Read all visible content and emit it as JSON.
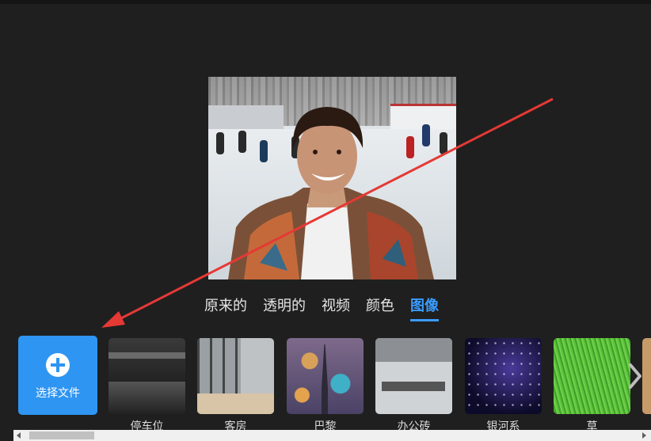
{
  "tabs": [
    {
      "label": "原来的"
    },
    {
      "label": "透明的"
    },
    {
      "label": "视频"
    },
    {
      "label": "颜色"
    },
    {
      "label": "图像",
      "active": true
    }
  ],
  "upload": {
    "label": "选择文件",
    "icon": "plus-circle-icon"
  },
  "backgrounds": [
    {
      "label": "停车位"
    },
    {
      "label": "客房"
    },
    {
      "label": "巴黎"
    },
    {
      "label": "办公砖"
    },
    {
      "label": "银河系"
    },
    {
      "label": "草"
    }
  ],
  "colors": {
    "accent": "#2f95f2",
    "active_tab": "#3b9cff",
    "background": "#1f1f1f",
    "annotation_arrow": "#e53935"
  },
  "icons": {
    "next": "chevron-right-icon",
    "scroll_left": "scroll-left-arrow-icon",
    "scroll_right": "scroll-right-arrow-icon"
  }
}
